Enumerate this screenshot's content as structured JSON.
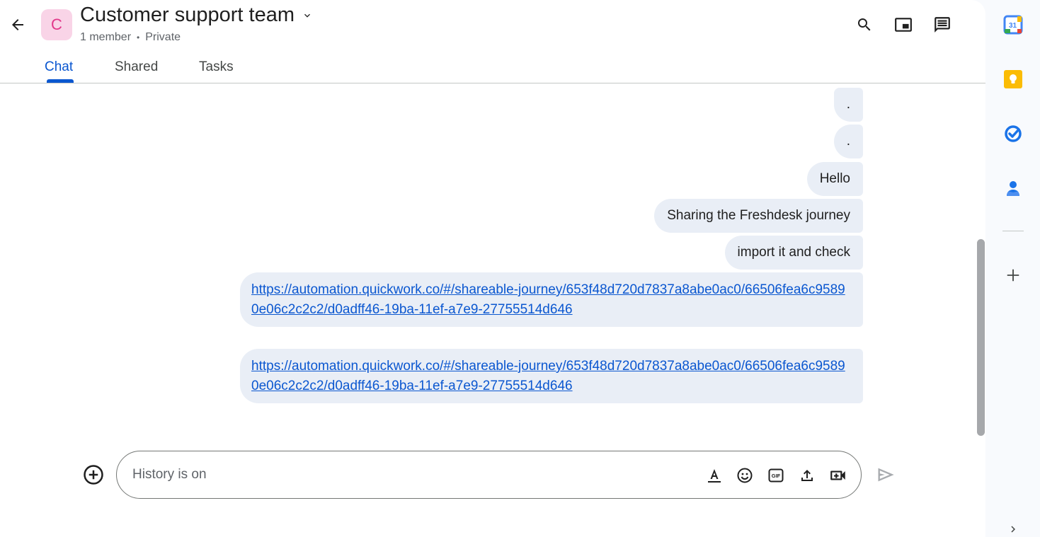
{
  "header": {
    "avatar_letter": "C",
    "title": "Customer support team",
    "member_count": "1 member",
    "separator": "•",
    "visibility": "Private"
  },
  "tabs": [
    {
      "label": "Chat",
      "active": true
    },
    {
      "label": "Shared",
      "active": false
    },
    {
      "label": "Tasks",
      "active": false
    }
  ],
  "messages": [
    {
      "text": "."
    },
    {
      "text": "."
    },
    {
      "text": "Hello"
    },
    {
      "text": "Sharing the Freshdesk journey"
    },
    {
      "text": "import it and check"
    },
    {
      "text": "https://automation.quickwork.co/#/shareable-journey/653f48d720d7837a8abe0ac0/66506fea6c95890e06c2c2c2/d0adff46-19ba-11ef-a7e9-27755514d646"
    },
    {
      "text": "https://automation.quickwork.co/#/shareable-journey/653f48d720d7837a8abe0ac0/66506fea6c95890e06c2c2c2/d0adff46-19ba-11ef-a7e9-27755514d646"
    }
  ],
  "compose": {
    "placeholder": "History is on",
    "gif_label": "GIF"
  },
  "rail": {
    "calendar_day": "31"
  },
  "colors": {
    "accent": "#0b57d0",
    "bubble": "#e9eef6",
    "avatar_bg": "#f9d4e7",
    "avatar_fg": "#e2388a"
  },
  "icons": [
    "back-arrow-icon",
    "chevron-down-icon",
    "search-icon",
    "picture-in-picture-icon",
    "threads-icon",
    "add-circle-icon",
    "format-text-icon",
    "emoji-icon",
    "gif-icon",
    "upload-icon",
    "video-meeting-icon",
    "send-icon",
    "calendar-icon",
    "keep-icon",
    "tasks-icon",
    "contacts-icon",
    "plus-icon",
    "chevron-right-icon"
  ]
}
